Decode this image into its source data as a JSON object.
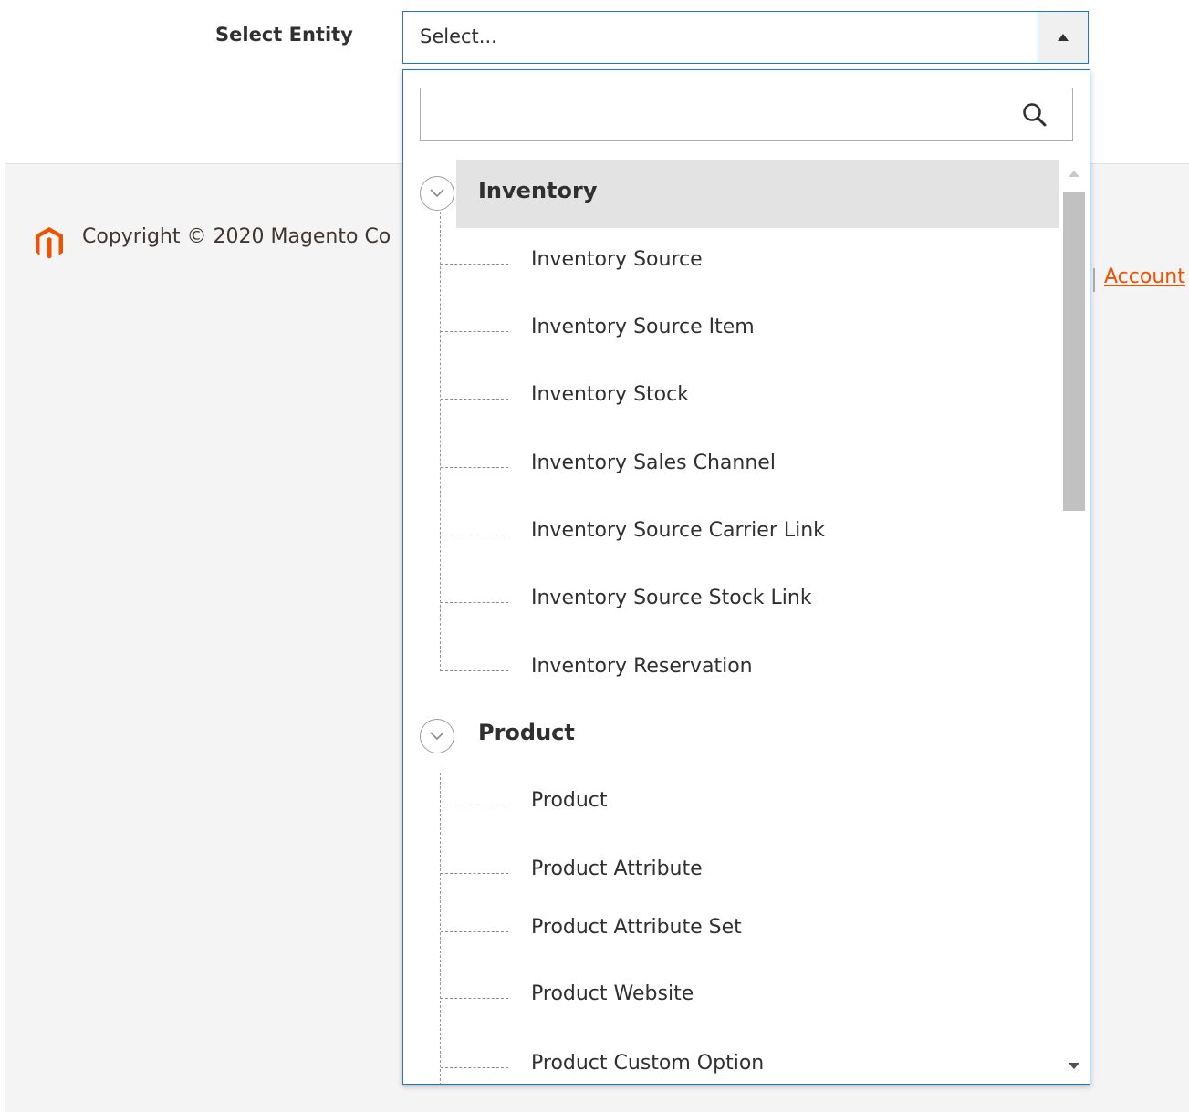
{
  "form": {
    "label": "Select Entity",
    "select_value": "Select..."
  },
  "search": {
    "value": "",
    "placeholder": ""
  },
  "tree": {
    "groups": [
      {
        "label": "Inventory",
        "expanded": true,
        "items": [
          "Inventory Source",
          "Inventory Source Item",
          "Inventory Stock",
          "Inventory Sales Channel",
          "Inventory Source Carrier Link",
          "Inventory Source Stock Link",
          "Inventory Reservation"
        ]
      },
      {
        "label": "Product",
        "expanded": true,
        "items": [
          "Product",
          "Product Attribute",
          "Product Attribute Set",
          "Product Website",
          "Product Custom Option"
        ]
      }
    ]
  },
  "footer": {
    "copyright": "Copyright © 2020 Magento Co",
    "account_link": "Account"
  },
  "colors": {
    "accent": "#1979c3",
    "highlight": "#e3e3e3",
    "brand": "#eb5202"
  },
  "icons": {
    "search": "search-icon",
    "toggle": "chevron-down-circle-icon",
    "select_arrow": "caret-up-icon",
    "logo": "magento-logo-icon"
  }
}
